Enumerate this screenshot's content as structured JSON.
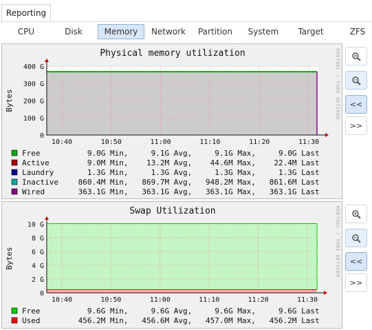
{
  "main_tab": "Reporting",
  "subtabs": [
    {
      "label": "CPU",
      "active": false
    },
    {
      "label": "Disk",
      "active": false
    },
    {
      "label": "Memory",
      "active": true
    },
    {
      "label": "Network",
      "active": false
    },
    {
      "label": "Partition",
      "active": false
    },
    {
      "label": "System",
      "active": false
    },
    {
      "label": "Target",
      "active": false
    },
    {
      "label": "ZFS",
      "active": false
    }
  ],
  "graph_buttons": {
    "zoom_in": "zoom-in-icon",
    "zoom_out": "zoom-out-icon",
    "back": "<<",
    "forward": ">>"
  },
  "watermark": "RRDTOOL / TOBI OETIKER",
  "chart_data": [
    {
      "type": "area",
      "title": "Physical memory utilization",
      "ylabel": "Bytes",
      "y_ticks": [
        "400 G",
        "300 G",
        "200 G",
        "100 G",
        "0"
      ],
      "y_tick_values": [
        400,
        300,
        200,
        100,
        0
      ],
      "ylim": [
        0,
        400
      ],
      "x_ticks": [
        "10:40",
        "10:50",
        "11:00",
        "11:10",
        "11:20",
        "11:30"
      ],
      "grid": true,
      "series": [
        {
          "name": "Free",
          "color": "#00aa00",
          "stats": {
            "min": "9.0G",
            "avg": "9.1G",
            "max": "9.1G",
            "last": "9.0G"
          },
          "value": 9.0
        },
        {
          "name": "Active",
          "color": "#aa0000",
          "stats": {
            "min": "9.0M",
            "avg": "13.2M",
            "max": "44.6M",
            "last": "22.4M"
          },
          "value": 0.0224
        },
        {
          "name": "Laundry",
          "color": "#000088",
          "stats": {
            "min": "1.3G",
            "avg": "1.3G",
            "max": "1.3G",
            "last": "1.3G"
          },
          "value": 1.3
        },
        {
          "name": "Inactive",
          "color": "#00aaaa",
          "stats": {
            "min": "860.4M",
            "avg": "869.7M",
            "max": "948.2M",
            "last": "861.6M"
          },
          "value": 0.8616
        },
        {
          "name": "Wired",
          "color": "#880088",
          "stats": {
            "min": "363.1G",
            "avg": "363.1G",
            "max": "363.1G",
            "last": "363.1G"
          },
          "value": 363.1
        }
      ]
    },
    {
      "type": "area",
      "title": "Swap Utilization",
      "ylabel": "Bytes",
      "y_ticks": [
        "10 G",
        "8 G",
        "6 G",
        "4 G",
        "2 G",
        "0"
      ],
      "y_tick_values": [
        10,
        8,
        6,
        4,
        2,
        0
      ],
      "ylim": [
        0,
        10
      ],
      "x_ticks": [
        "10:40",
        "10:50",
        "11:00",
        "11:10",
        "11:20",
        "11:30"
      ],
      "grid": true,
      "series": [
        {
          "name": "Free",
          "color": "#00cc00",
          "stats": {
            "min": "9.6G",
            "avg": "9.6G",
            "max": "9.6G",
            "last": "9.6G"
          },
          "value": 9.6
        },
        {
          "name": "Used",
          "color": "#ff0000",
          "stats": {
            "min": "456.2M",
            "avg": "456.6M",
            "max": "457.0M",
            "last": "456.2M"
          },
          "value": 0.4562
        }
      ]
    }
  ]
}
